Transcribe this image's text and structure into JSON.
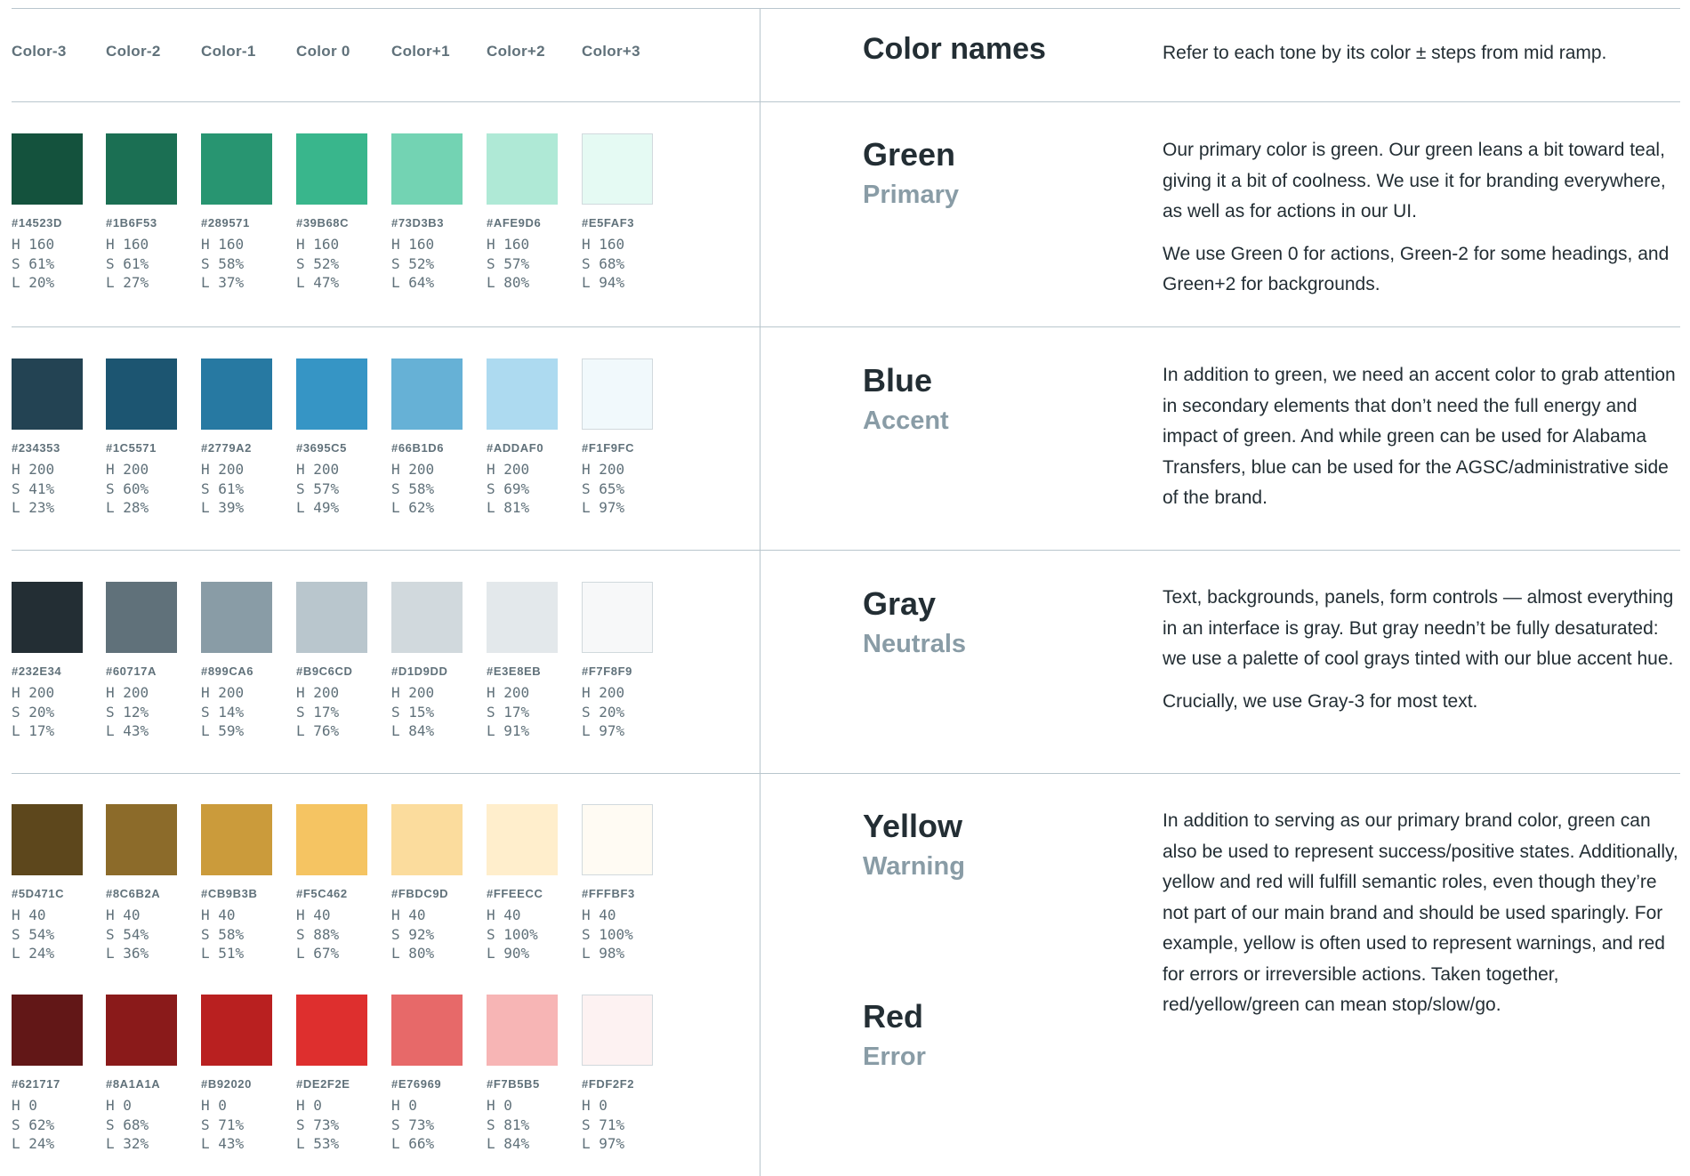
{
  "header": {
    "columns": [
      "Color-3",
      "Color-2",
      "Color-1",
      "Color 0",
      "Color+1",
      "Color+2",
      "Color+3"
    ],
    "title": "Color names",
    "intro": "Refer to each tone by its color ± steps from mid ramp."
  },
  "ramps": [
    {
      "name": "Green",
      "swatches": [
        {
          "hex": "#14523D",
          "h": "H 160",
          "s": "S 61%",
          "l": "L 20%"
        },
        {
          "hex": "#1B6F53",
          "h": "H 160",
          "s": "S 61%",
          "l": "L 27%"
        },
        {
          "hex": "#289571",
          "h": "H 160",
          "s": "S 58%",
          "l": "L 37%"
        },
        {
          "hex": "#39B68C",
          "h": "H 160",
          "s": "S 52%",
          "l": "L 47%"
        },
        {
          "hex": "#73D3B3",
          "h": "H 160",
          "s": "S 52%",
          "l": "L 64%"
        },
        {
          "hex": "#AFE9D6",
          "h": "H 160",
          "s": "S 57%",
          "l": "L 80%"
        },
        {
          "hex": "#E5FAF3",
          "h": "H 160",
          "s": "S 68%",
          "l": "L 94%"
        }
      ]
    },
    {
      "name": "Blue",
      "swatches": [
        {
          "hex": "#234353",
          "h": "H 200",
          "s": "S 41%",
          "l": "L 23%"
        },
        {
          "hex": "#1C5571",
          "h": "H 200",
          "s": "S 60%",
          "l": "L 28%"
        },
        {
          "hex": "#2779A2",
          "h": "H 200",
          "s": "S 61%",
          "l": "L 39%"
        },
        {
          "hex": "#3695C5",
          "h": "H 200",
          "s": "S 57%",
          "l": "L 49%"
        },
        {
          "hex": "#66B1D6",
          "h": "H 200",
          "s": "S 58%",
          "l": "L 62%"
        },
        {
          "hex": "#ADDAF0",
          "h": "H 200",
          "s": "S 69%",
          "l": "L 81%"
        },
        {
          "hex": "#F1F9FC",
          "h": "H 200",
          "s": "S 65%",
          "l": "L 97%"
        }
      ]
    },
    {
      "name": "Gray",
      "swatches": [
        {
          "hex": "#232E34",
          "h": "H 200",
          "s": "S 20%",
          "l": "L 17%"
        },
        {
          "hex": "#60717A",
          "h": "H 200",
          "s": "S 12%",
          "l": "L 43%"
        },
        {
          "hex": "#899CA6",
          "h": "H 200",
          "s": "S 14%",
          "l": "L 59%"
        },
        {
          "hex": "#B9C6CD",
          "h": "H 200",
          "s": "S 17%",
          "l": "L 76%"
        },
        {
          "hex": "#D1D9DD",
          "h": "H 200",
          "s": "S 15%",
          "l": "L 84%"
        },
        {
          "hex": "#E3E8EB",
          "h": "H 200",
          "s": "S 17%",
          "l": "L 91%"
        },
        {
          "hex": "#F7F8F9",
          "h": "H 200",
          "s": "S 20%",
          "l": "L 97%"
        }
      ]
    },
    {
      "name": "Yellow",
      "swatches": [
        {
          "hex": "#5D471C",
          "h": "H 40",
          "s": "S 54%",
          "l": "L 24%"
        },
        {
          "hex": "#8C6B2A",
          "h": "H 40",
          "s": "S 54%",
          "l": "L 36%"
        },
        {
          "hex": "#CB9B3B",
          "h": "H 40",
          "s": "S 58%",
          "l": "L 51%"
        },
        {
          "hex": "#F5C462",
          "h": "H 40",
          "s": "S 88%",
          "l": "L 67%"
        },
        {
          "hex": "#FBDC9D",
          "h": "H 40",
          "s": "S 92%",
          "l": "L 80%"
        },
        {
          "hex": "#FFEECC",
          "h": "H 40",
          "s": "S 100%",
          "l": "L 90%"
        },
        {
          "hex": "#FFFBF3",
          "h": "H 40",
          "s": "S 100%",
          "l": "L 98%"
        }
      ]
    },
    {
      "name": "Red",
      "swatches": [
        {
          "hex": "#621717",
          "h": "H 0",
          "s": "S 62%",
          "l": "L 24%"
        },
        {
          "hex": "#8A1A1A",
          "h": "H 0",
          "s": "S 68%",
          "l": "L 32%"
        },
        {
          "hex": "#B92020",
          "h": "H 0",
          "s": "S 71%",
          "l": "L 43%"
        },
        {
          "hex": "#DE2F2E",
          "h": "H 0",
          "s": "S 73%",
          "l": "L 53%"
        },
        {
          "hex": "#E76969",
          "h": "H 0",
          "s": "S 73%",
          "l": "L 66%"
        },
        {
          "hex": "#F7B5B5",
          "h": "H 0",
          "s": "S 81%",
          "l": "L 84%"
        },
        {
          "hex": "#FDF2F2",
          "h": "H 0",
          "s": "S 71%",
          "l": "L 97%"
        }
      ]
    }
  ],
  "sections": {
    "green": {
      "name": "Green",
      "role": "Primary",
      "paragraphs": [
        "Our primary color is green. Our green leans a bit toward teal, giving it a bit of coolness. We use it for branding everywhere, as well as for actions in our UI.",
        "We use Green 0 for actions, Green-2 for some headings, and Green+2 for backgrounds."
      ]
    },
    "blue": {
      "name": "Blue",
      "role": "Accent",
      "paragraphs": [
        "In addition to green, we need an accent color to grab attention in secondary elements that don’t need the full energy and impact of green. And while green can be used for Alabama Transfers, blue can be used for the AGSC/administrative side of the brand."
      ]
    },
    "gray": {
      "name": "Gray",
      "role": "Neutrals",
      "paragraphs": [
        "Text, backgrounds, panels, form controls — almost everything in an interface is gray. But gray needn’t be fully desaturated: we use a palette of cool grays tinted with our blue accent hue.",
        "Crucially, we use Gray-3 for most text."
      ]
    },
    "yellow": {
      "name": "Yellow",
      "role": "Warning"
    },
    "red": {
      "name": "Red",
      "role": "Error"
    },
    "semantic": {
      "paragraphs": [
        "In addition to serving as our primary brand color, green can also be used to represent success/positive states. Additionally, yellow and red will fulfill semantic roles, even though they’re not part of our main brand and should be used sparingly. For example, yellow is often used to represent warnings, and red for errors or irreversible actions. Taken together, red/yellow/green can mean stop/slow/go."
      ]
    }
  }
}
